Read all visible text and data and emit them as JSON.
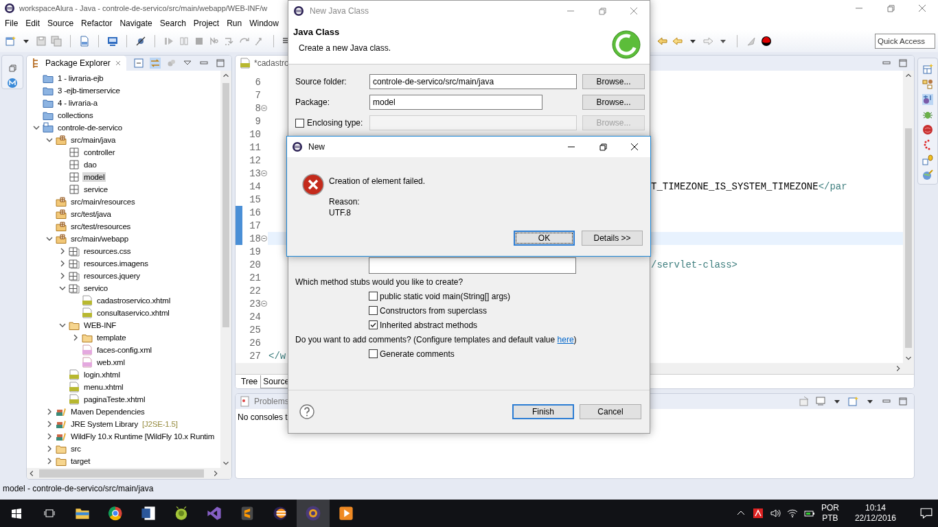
{
  "window": {
    "title": "workspaceAlura - Java - controle-de-servico/src/main/webapp/WEB-INF/w"
  },
  "menu": [
    "File",
    "Edit",
    "Source",
    "Refactor",
    "Navigate",
    "Search",
    "Project",
    "Run",
    "Window"
  ],
  "quick_access": {
    "placeholder": "Quick Access"
  },
  "package_explorer": {
    "title": "Package Explorer",
    "items": [
      {
        "label": "1 - livraria-ejb",
        "kind": "project",
        "selected": false
      },
      {
        "label": "3 -ejb-timerservice",
        "kind": "project",
        "selected": false
      },
      {
        "label": "4 - livraria-a",
        "kind": "project",
        "selected": false
      },
      {
        "label": "collections",
        "kind": "project",
        "selected": false
      },
      {
        "label": "controle-de-servico",
        "kind": "maven",
        "expanded": true,
        "selected": false,
        "children": [
          {
            "label": "src/main/java",
            "kind": "source",
            "expanded": true,
            "selected": false,
            "children": [
              {
                "label": "controller",
                "kind": "package",
                "selected": false
              },
              {
                "label": "dao",
                "kind": "package",
                "selected": false
              },
              {
                "label": "model",
                "kind": "package",
                "selected": true
              },
              {
                "label": "service",
                "kind": "package",
                "selected": false
              }
            ]
          },
          {
            "label": "src/main/resources",
            "kind": "source",
            "selected": false
          },
          {
            "label": "src/test/java",
            "kind": "source",
            "selected": false
          },
          {
            "label": "src/test/resources",
            "kind": "source",
            "selected": false
          },
          {
            "label": "src/main/webapp",
            "kind": "source",
            "expanded": true,
            "selected": false,
            "children": [
              {
                "label": "resources.css",
                "kind": "webpackage",
                "expanded": false,
                "selected": false
              },
              {
                "label": "resources.imagens",
                "kind": "webpackage",
                "expanded": false,
                "selected": false
              },
              {
                "label": "resources.jquery",
                "kind": "webpackage",
                "expanded": false,
                "selected": false
              },
              {
                "label": "servico",
                "kind": "webpackage",
                "expanded": true,
                "selected": false,
                "children": [
                  {
                    "label": "cadastroservico.xhtml",
                    "kind": "html",
                    "selected": false
                  },
                  {
                    "label": "consultaservico.xhtml",
                    "kind": "html",
                    "selected": false
                  }
                ]
              },
              {
                "label": "WEB-INF",
                "kind": "folder",
                "expanded": true,
                "selected": false,
                "children": [
                  {
                    "label": "template",
                    "kind": "folder",
                    "expanded": false,
                    "selected": false
                  },
                  {
                    "label": "faces-config.xml",
                    "kind": "xml",
                    "selected": false
                  },
                  {
                    "label": "web.xml",
                    "kind": "xml",
                    "selected": false
                  }
                ]
              },
              {
                "label": "login.xhtml",
                "kind": "html",
                "selected": false
              },
              {
                "label": "menu.xhtml",
                "kind": "html",
                "selected": false
              },
              {
                "label": "paginaTeste.xhtml",
                "kind": "html",
                "selected": false
              }
            ]
          },
          {
            "label": "Maven Dependencies",
            "kind": "library",
            "expanded": false,
            "selected": false
          },
          {
            "label": "JRE System Library",
            "decoration": "[J2SE-1.5]",
            "kind": "library",
            "expanded": false,
            "selected": false
          },
          {
            "label": "WildFly 10.x Runtime [WildFly 10.x Runtim",
            "kind": "library",
            "expanded": false,
            "selected": false
          },
          {
            "label": "src",
            "kind": "folder",
            "expanded": false,
            "selected": false
          },
          {
            "label": "target",
            "kind": "folder",
            "expanded": false,
            "selected": false
          }
        ]
      }
    ]
  },
  "editor": {
    "tab": "*cadastro",
    "lines": [
      {
        "number": "6",
        "fold": false,
        "changed": false,
        "current": false
      },
      {
        "number": "7",
        "fold": false,
        "changed": false,
        "current": false
      },
      {
        "number": "8",
        "fold": true,
        "changed": false,
        "current": false
      },
      {
        "number": "9",
        "fold": false,
        "changed": false,
        "current": false
      },
      {
        "number": "10",
        "fold": false,
        "changed": false,
        "current": false
      },
      {
        "number": "11",
        "fold": false,
        "changed": false,
        "current": false
      },
      {
        "number": "12",
        "fold": false,
        "changed": false,
        "current": false
      },
      {
        "number": "13",
        "fold": true,
        "changed": false,
        "current": false
      },
      {
        "number": "14",
        "fold": false,
        "changed": false,
        "current": false,
        "kind": "tail",
        "code": [
          {
            "text": "T_TIMEZONE_IS_SYSTEM_TIMEZONE",
            "kind": "text"
          },
          {
            "text": "</par",
            "kind": "tag"
          }
        ]
      },
      {
        "number": "15",
        "fold": false,
        "changed": false,
        "current": false
      },
      {
        "number": "16",
        "fold": false,
        "changed": true,
        "current": false
      },
      {
        "number": "17",
        "fold": false,
        "changed": true,
        "current": false
      },
      {
        "number": "18",
        "fold": true,
        "changed": true,
        "current": true
      },
      {
        "number": "19",
        "fold": false,
        "changed": false,
        "current": false
      },
      {
        "number": "20",
        "fold": false,
        "changed": false,
        "current": false,
        "kind": "tail",
        "code": [
          {
            "text": "/servlet-class>",
            "kind": "tag"
          }
        ]
      },
      {
        "number": "21",
        "fold": false,
        "changed": false,
        "current": false
      },
      {
        "number": "22",
        "fold": false,
        "changed": false,
        "current": false
      },
      {
        "number": "23",
        "fold": true,
        "changed": false,
        "current": false
      },
      {
        "number": "24",
        "fold": false,
        "changed": false,
        "current": false
      },
      {
        "number": "25",
        "fold": false,
        "changed": false,
        "current": false
      },
      {
        "number": "26",
        "fold": false,
        "changed": false,
        "current": false
      },
      {
        "number": "27",
        "fold": false,
        "changed": false,
        "current": false,
        "kind": "head",
        "code": [
          {
            "text": "</w",
            "kind": "tag"
          }
        ]
      }
    ],
    "bottom_tabs": [
      {
        "label": "Tree",
        "selected": false
      },
      {
        "label": "Source",
        "selected": true
      }
    ]
  },
  "console": {
    "tab": "Problems",
    "message": "No consoles t"
  },
  "status_bar": "model - controle-de-servico/src/main/java",
  "new_class_dialog": {
    "title": "New Java Class",
    "active": false,
    "heading": "Java Class",
    "description": "Create a new Java class.",
    "fields": [
      {
        "label": "Source folder:",
        "kind": "wide",
        "value": "controle-de-servico/src/main/java",
        "button": "Browse...",
        "disabled": false
      },
      {
        "label": "Package:",
        "kind": "narrow",
        "value": "model",
        "button": "Browse...",
        "disabled": false
      },
      {
        "label": "Enclosing type:",
        "kind": "checkbox",
        "checked": false,
        "button": "Browse...",
        "disabled": true
      }
    ],
    "stubs_question": "Which method stubs would you like to create?",
    "stubs": [
      {
        "label": "public static void main(String[] args)",
        "checked": false
      },
      {
        "label": "Constructors from superclass",
        "checked": false
      },
      {
        "label": "Inherited abstract methods",
        "checked": true
      }
    ],
    "comments_question": "Do you want to add comments? (Configure templates and default value ",
    "comments_link": "here",
    "comments_end": ")",
    "comments_option": {
      "label": "Generate comments",
      "checked": false
    },
    "buttons": [
      {
        "label": "Finish",
        "default": true
      },
      {
        "label": "Cancel",
        "default": false
      }
    ]
  },
  "error_dialog": {
    "title": "New",
    "active": true,
    "message": "Creation of element failed.",
    "reason_label": "Reason:",
    "reason": "UTF.8",
    "buttons": [
      {
        "label": "OK",
        "default": true
      },
      {
        "label": "Details >>",
        "default": false
      }
    ]
  },
  "taskbar": {
    "language": "POR",
    "layout": "PTB",
    "time": "10:14",
    "date": "22/12/2016"
  }
}
